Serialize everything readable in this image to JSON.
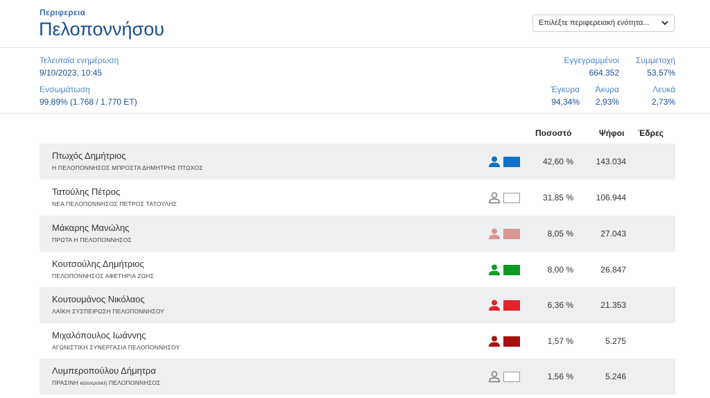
{
  "header": {
    "region_label": "Περιφερεια",
    "region_title": "Πελοποννήσου",
    "select_value": "Επιλέξτε περιφερειακή ενότητα..."
  },
  "stats": {
    "last_update_label": "Τελευταία ενημέρωση",
    "last_update_value": "9/10/2023, 10:45",
    "integration_label": "Ενσωμάτωση",
    "integration_value": "99,89% (1.768 / 1.770 ΕΤ)",
    "registered_label": "Εγγεγραμμένοι",
    "registered_value": "664.352",
    "turnout_label": "Συμμετοχή",
    "turnout_value": "53,57%",
    "valid_label": "Έγκυρα",
    "valid_value": "94,34%",
    "invalid_label": "Άκυρα",
    "invalid_value": "2,93%",
    "blank_label": "Λευκά",
    "blank_value": "2,73%"
  },
  "table": {
    "col_percent": "Ποσοστό",
    "col_votes": "Ψήφοι",
    "col_seats": "Έδρες",
    "rows": [
      {
        "candidate": "Πτωχός Δημήτριος",
        "party": "Η ΠΕΛΟΠΟΝΝΗΣΟΣ ΜΠΡΟΣΤΑ ΔΗΜΗΤΡΗΣ ΠΤΩΧΟΣ",
        "percent": "42,60 %",
        "votes": "143.034",
        "seats": "",
        "color": "#0d72c8",
        "icon": "person-icon-blue"
      },
      {
        "candidate": "Τατούλης Πέτρος",
        "party": "ΝΕΑ ΠΕΛΟΠΟΝΝΗΣΟΣ ΠΕΤΡΟΣ ΤΑΤΟΥΛΗΣ",
        "percent": "31,85 %",
        "votes": "106.944",
        "seats": "",
        "color": "#ffffff",
        "icon": "person-outline-icon"
      },
      {
        "candidate": "Μάκαρης Μανώλης",
        "party": "ΠΡΩΤΑ Η ΠΕΛΟΠΟΝΝΗΣΟΣ",
        "percent": "8,05 %",
        "votes": "27.043",
        "seats": "",
        "color": "#d99592",
        "icon": "person-icon-pink"
      },
      {
        "candidate": "Κουτσούλης Δημήτριος",
        "party": "ΠΕΛΟΠΟΝΝΗΣΟΣ ΑΦΕΤΗΡΙΑ ΖΩΗΣ",
        "percent": "8,00 %",
        "votes": "26.847",
        "seats": "",
        "color": "#0e9b25",
        "icon": "person-icon-green"
      },
      {
        "candidate": "Κουτουμάνος Νικόλαος",
        "party": "ΛΑΪΚΗ ΣΥΣΠΕΙΡΩΣΗ ΠΕΛΟΠΟΝΝΗΣΟΥ",
        "percent": "6,36 %",
        "votes": "21.353",
        "seats": "",
        "color": "#e5232a",
        "icon": "person-icon-red"
      },
      {
        "candidate": "Μιχαλόπουλος Ιωάννης",
        "party": "ΑΓΩΝΙΣΤΙΚΗ ΣΥΝΕΡΓΑΣΙΑ ΠΕΛΟΠΟΝΝΗΣΟΥ",
        "percent": "1,57 %",
        "votes": "5.275",
        "seats": "",
        "color": "#a51212",
        "icon": "person-icon-darkred"
      },
      {
        "candidate": "Λυμπεροπούλου Δήμητρα",
        "party": "ΠΡΑΣΙΝΗ κοινωνική ΠΕΛΟΠΟΝΝΗΣΟΣ",
        "percent": "1,56 %",
        "votes": "5.246",
        "seats": "",
        "color": "#ffffff",
        "icon": "person-outline-icon"
      }
    ]
  }
}
